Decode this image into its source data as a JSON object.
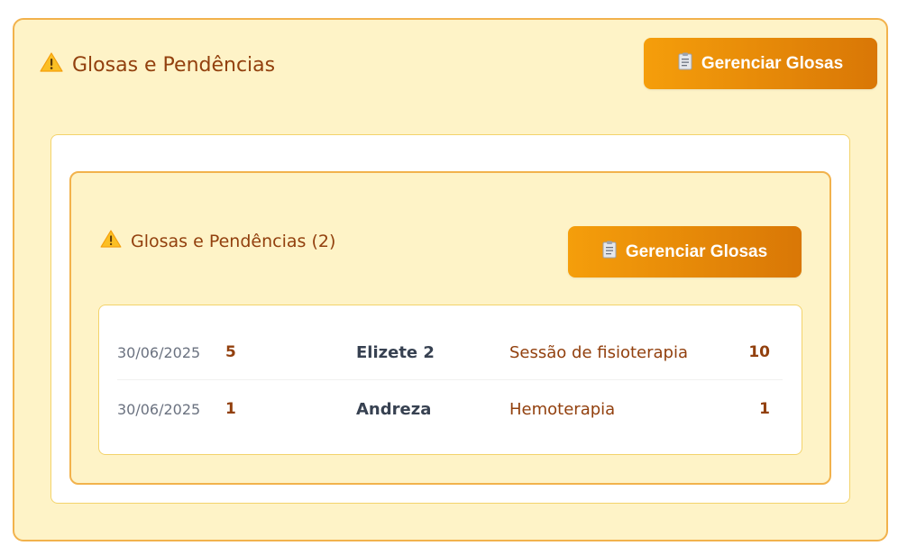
{
  "outer": {
    "title": "Glosas e Pendências",
    "button_label": "Gerenciar Glosas",
    "title_icon": "warning-icon",
    "button_icon": "clipboard-icon"
  },
  "inner": {
    "title": "Glosas e Pendências (2)",
    "button_label": "Gerenciar Glosas",
    "rows": [
      {
        "date": "30/06/2025",
        "qty": "5",
        "name": "Elizete 2",
        "procedure": "Sessão de fisioterapia",
        "value": "10"
      },
      {
        "date": "30/06/2025",
        "qty": "1",
        "name": "Andreza",
        "procedure": "Hemoterapia",
        "value": "1"
      }
    ]
  },
  "colors": {
    "panel_bg": "#fef3c7",
    "panel_border": "#f2b24c",
    "accent_start": "#f59e0b",
    "accent_end": "#d97706",
    "title_text": "#92400e"
  }
}
